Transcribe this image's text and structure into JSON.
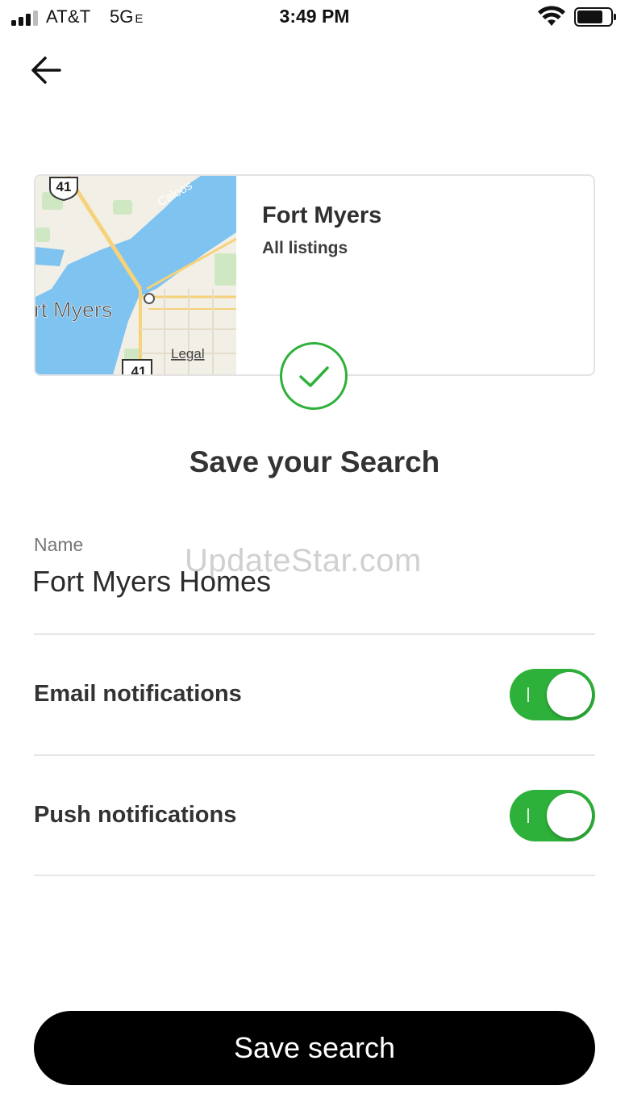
{
  "status_bar": {
    "carrier": "AT&T",
    "network": "5G",
    "network_suffix": "E",
    "time": "3:49 PM",
    "signal_bars_active": 3,
    "signal_bars_total": 4
  },
  "navigation": {
    "back_icon": "arrow-left-icon"
  },
  "search_card": {
    "title": "Fort Myers",
    "subtitle": "All listings",
    "map": {
      "city_label": "rt Myers",
      "river_label": "Caloos",
      "route_shield_top": "41",
      "route_shield_bottom": "41",
      "legal_link": "Legal",
      "water_color": "#7fc3f0",
      "land_color": "#f2efe6",
      "park_color": "#cfe8c3",
      "road_color": "#f6d27a"
    }
  },
  "success_icon": "check-circle-icon",
  "page_title": "Save your Search",
  "name_field": {
    "label": "Name",
    "value": "Fort Myers Homes"
  },
  "watermark": "UpdateStar.com",
  "settings": {
    "email_notifications": {
      "label": "Email notifications",
      "enabled": true
    },
    "push_notifications": {
      "label": "Push notifications",
      "enabled": true
    }
  },
  "save_button_label": "Save search",
  "colors": {
    "accent_green": "#2eb13a",
    "button_black": "#000000"
  }
}
